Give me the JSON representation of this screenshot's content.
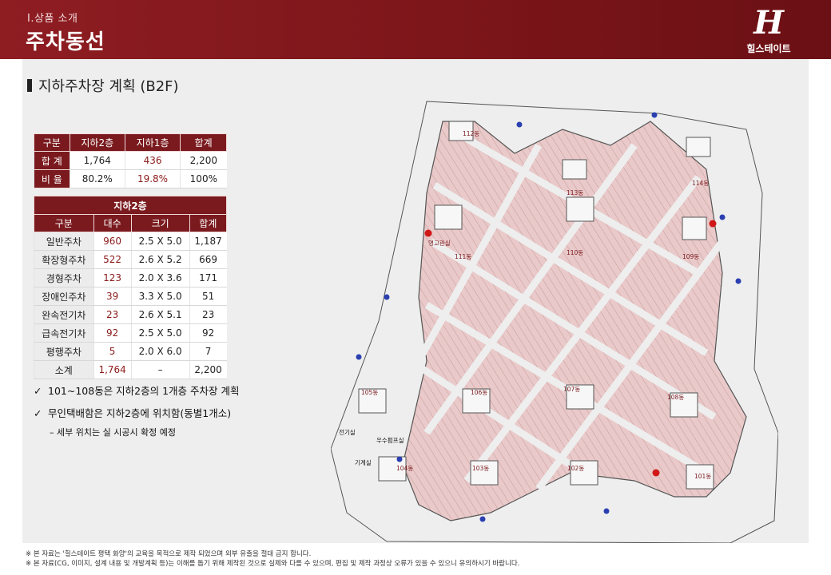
{
  "header": {
    "subtitle": "Ⅰ.상품 소개",
    "title": "주차동선",
    "logo_brand": "힐스테이트",
    "logo_mark": "H"
  },
  "section": {
    "title": "지하주차장 계획 (B2F)"
  },
  "summary_table": {
    "headers": [
      "구분",
      "지하2층",
      "지하1층",
      "합계"
    ],
    "rows": [
      {
        "label": "합 계",
        "b2": "1,764",
        "b1": "436",
        "total": "2,200"
      },
      {
        "label": "비 율",
        "b2": "80.2%",
        "b1": "19.8%",
        "total": "100%"
      }
    ]
  },
  "b2_table": {
    "caption": "지하2층",
    "headers": [
      "구분",
      "대수",
      "크기",
      "합계"
    ],
    "rows": [
      {
        "label": "일반주차",
        "count": "960",
        "size": "2.5 X 5.0",
        "total": "1,187"
      },
      {
        "label": "확장형주차",
        "count": "522",
        "size": "2.6 X 5.2",
        "total": "669"
      },
      {
        "label": "경형주차",
        "count": "123",
        "size": "2.0 X 3.6",
        "total": "171"
      },
      {
        "label": "장애인주차",
        "count": "39",
        "size": "3.3 X 5.0",
        "total": "51"
      },
      {
        "label": "완속전기차",
        "count": "23",
        "size": "2.6 X 5.1",
        "total": "23"
      },
      {
        "label": "급속전기차",
        "count": "92",
        "size": "2.5 X 5.0",
        "total": "92"
      },
      {
        "label": "평행주차",
        "count": "5",
        "size": "2.0 X 6.0",
        "total": "7"
      },
      {
        "label": "소계",
        "count": "1,764",
        "size": "–",
        "total": "2,200"
      }
    ]
  },
  "notes": {
    "check1": "101~108동은 지하2층의 1개층 주차장 계획",
    "check2": "무인택배함은 지하2층에 위치함(동별1개소)",
    "sub": "– 세부 위치는 실 시공시 확정 예정"
  },
  "plan_labels": {
    "b101": "101동",
    "b102": "102동",
    "b103": "103동",
    "b104": "104동",
    "b105": "105동",
    "b106": "106동",
    "b107": "107동",
    "b108": "108동",
    "b109": "109동",
    "b110": "110동",
    "b111": "111동",
    "b112": "112동",
    "b113": "113동",
    "b114": "114동",
    "elec": "전기실",
    "mech": "기계실",
    "meeting": "명고관실",
    "pump": "우수펌프실"
  },
  "footer": {
    "line1": "※ 본 자료는 '힐스테이트 평택 화양'의 교육을 목적으로 제작 되었으며 외부 유출을 절대 금지 합니다.",
    "line2": "※ 본 자료(CG, 이미지, 설계 내용 및 개발계획 등)는 이해를 돕기 위해 제작된 것으로 실제와 다를 수 있으며, 편집 및 제작 과정상 오류가 있을 수 있으니 유의하시기 바랍니다."
  },
  "colors": {
    "brand": "#7a1a1e",
    "accent_red": "#8b1a1a",
    "lot_pink": "#e8c9c9"
  }
}
